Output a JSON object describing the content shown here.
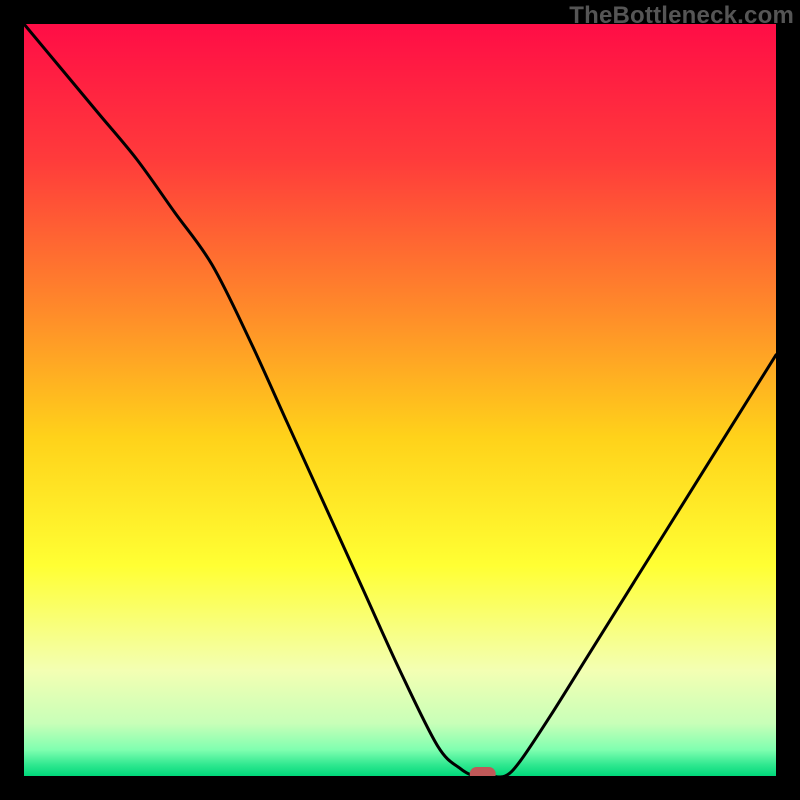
{
  "watermark": "TheBottleneck.com",
  "chart_data": {
    "type": "line",
    "title": "",
    "xlabel": "",
    "ylabel": "",
    "xlim": [
      0,
      100
    ],
    "ylim": [
      0,
      100
    ],
    "x": [
      0,
      5,
      10,
      15,
      20,
      25,
      30,
      35,
      40,
      45,
      50,
      55,
      58,
      60,
      62,
      64,
      66,
      70,
      75,
      80,
      85,
      90,
      95,
      100
    ],
    "values": [
      100,
      94,
      88,
      82,
      75,
      68,
      58,
      47,
      36,
      25,
      14,
      4,
      1,
      0,
      0,
      0,
      2,
      8,
      16,
      24,
      32,
      40,
      48,
      56
    ],
    "marker": {
      "x": 61,
      "y": 0
    },
    "gradient_stops": [
      {
        "offset": 0.0,
        "color": "#ff0d46"
      },
      {
        "offset": 0.18,
        "color": "#ff3b3b"
      },
      {
        "offset": 0.38,
        "color": "#ff8a2a"
      },
      {
        "offset": 0.55,
        "color": "#ffd21a"
      },
      {
        "offset": 0.72,
        "color": "#ffff33"
      },
      {
        "offset": 0.86,
        "color": "#f3ffb3"
      },
      {
        "offset": 0.93,
        "color": "#c8ffb8"
      },
      {
        "offset": 0.965,
        "color": "#80ffb0"
      },
      {
        "offset": 0.985,
        "color": "#30e890"
      },
      {
        "offset": 1.0,
        "color": "#00d87a"
      }
    ]
  }
}
